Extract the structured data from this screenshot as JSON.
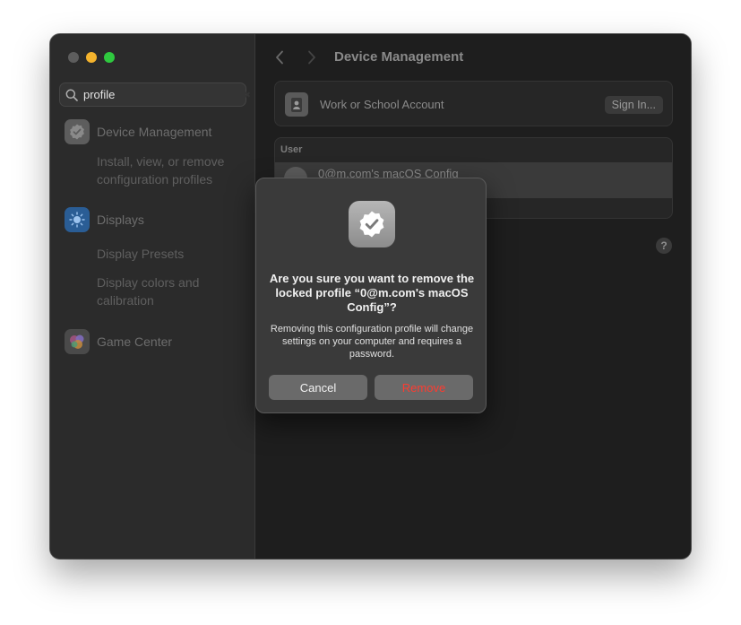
{
  "search": {
    "value": "profile"
  },
  "sidebar": {
    "items": [
      {
        "label": "Device Management",
        "icon": "checkmark-seal-icon",
        "color": "#8a8a8a"
      },
      {
        "label": "Displays",
        "icon": "sun-icon",
        "color": "#2f6fb5"
      },
      {
        "label": "Game Center",
        "icon": "game-center-icon",
        "color": "#7a5aa5"
      }
    ],
    "sub": {
      "device_management": "Install, view, or remove configuration profiles",
      "display_presets": "Display Presets",
      "display_colors": "Display colors and calibration"
    }
  },
  "main": {
    "title": "Device Management",
    "account_label": "Work or School Account",
    "signin_label": "Sign In...",
    "user_header": "User",
    "profile_name": "0@m.com's macOS Config",
    "help_label": "?"
  },
  "dialog": {
    "title": "Are you sure you want to remove the locked profile “0@m.com's macOS Config”?",
    "body": "Removing this configuration profile will change settings on your computer and requires a password.",
    "cancel_label": "Cancel",
    "remove_label": "Remove",
    "remove_color": "#ff3b30"
  }
}
